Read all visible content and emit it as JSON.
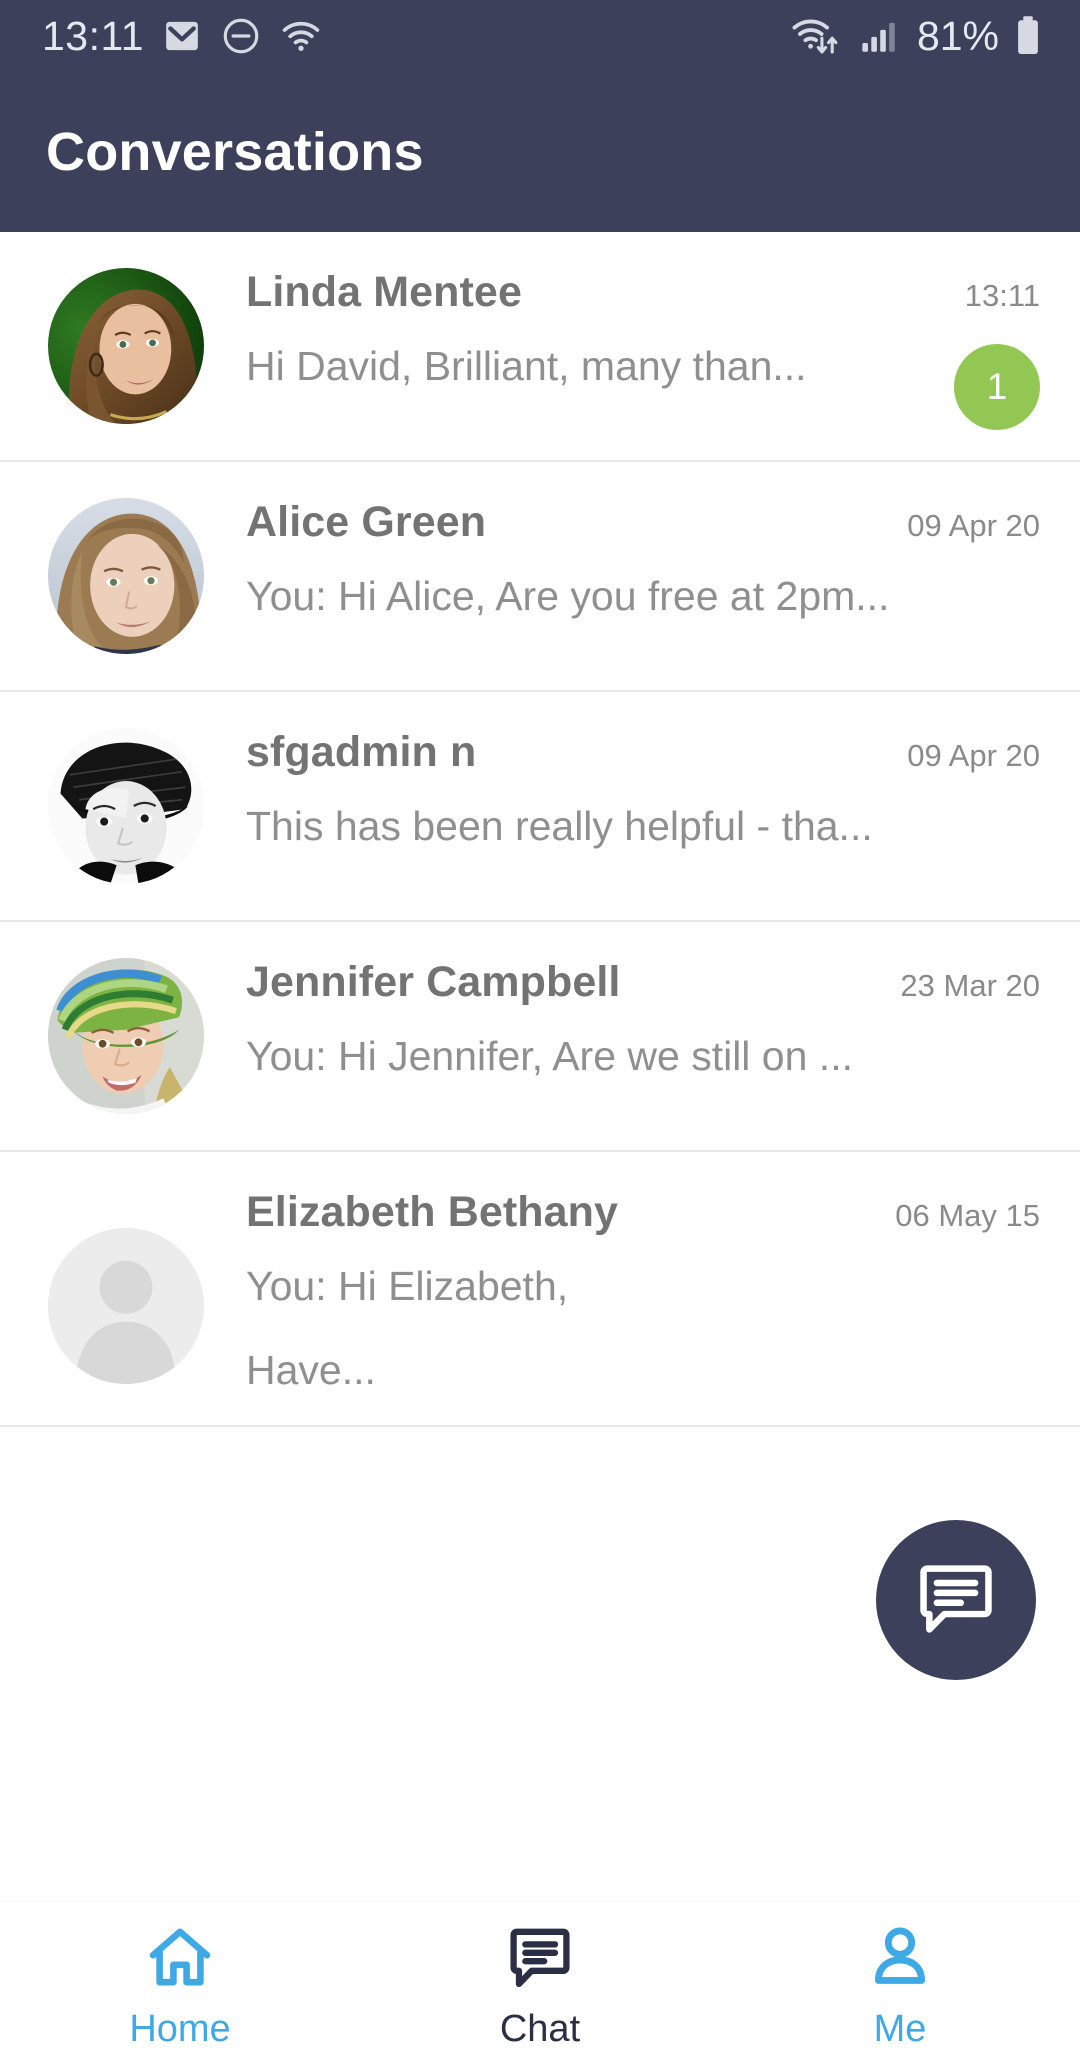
{
  "status_bar": {
    "time": "13:11",
    "battery_percent": "81%",
    "icons": [
      "mail-icon",
      "do-not-disturb-icon",
      "wifi-icon",
      "wifi-data-icon",
      "cellular-signal-icon",
      "battery-icon"
    ]
  },
  "app_bar": {
    "title": "Conversations",
    "background_color": "#3c405a",
    "title_color": "#ffffff"
  },
  "conversations": [
    {
      "name": "Linda Mentee",
      "preview": "Hi David, Brilliant, many than...",
      "timestamp": "13:11",
      "unread_count": "1",
      "avatar": "photo-woman-green-background"
    },
    {
      "name": "Alice Green",
      "preview": "You: Hi Alice, Are you free at 2pm...",
      "timestamp": "09 Apr 20",
      "unread_count": null,
      "avatar": "photo-woman-closeup"
    },
    {
      "name": "sfgadmin n",
      "preview": "This has been really helpful - tha...",
      "timestamp": "09 Apr 20",
      "unread_count": null,
      "avatar": "photo-person-black-white-hat"
    },
    {
      "name": "Jennifer Campbell",
      "preview": "You: Hi Jennifer, Are we still on ...",
      "timestamp": "23 Mar 20",
      "unread_count": null,
      "avatar": "photo-woman-colorful-headscarf"
    },
    {
      "name": "Elizabeth Bethany",
      "preview_line1": "You: Hi Elizabeth,",
      "preview_line2": "Have...",
      "timestamp": "06 May 15",
      "unread_count": null,
      "avatar": "placeholder-person-icon"
    }
  ],
  "fab": {
    "icon": "new-chat-icon",
    "background_color": "#3c405a"
  },
  "bottom_nav": {
    "items": [
      {
        "label": "Home",
        "icon": "home-icon",
        "active": false,
        "color": "#3fa9e5"
      },
      {
        "label": "Chat",
        "icon": "chat-icon",
        "active": true,
        "color": "#2b2f45"
      },
      {
        "label": "Me",
        "icon": "person-icon",
        "active": false,
        "color": "#3fa9e5"
      }
    ]
  },
  "colors": {
    "accent_blue": "#3fa9e5",
    "badge_green": "#93c753",
    "header_navy": "#3c405a",
    "name_grey": "#737373",
    "preview_grey": "#8f8f8f"
  }
}
